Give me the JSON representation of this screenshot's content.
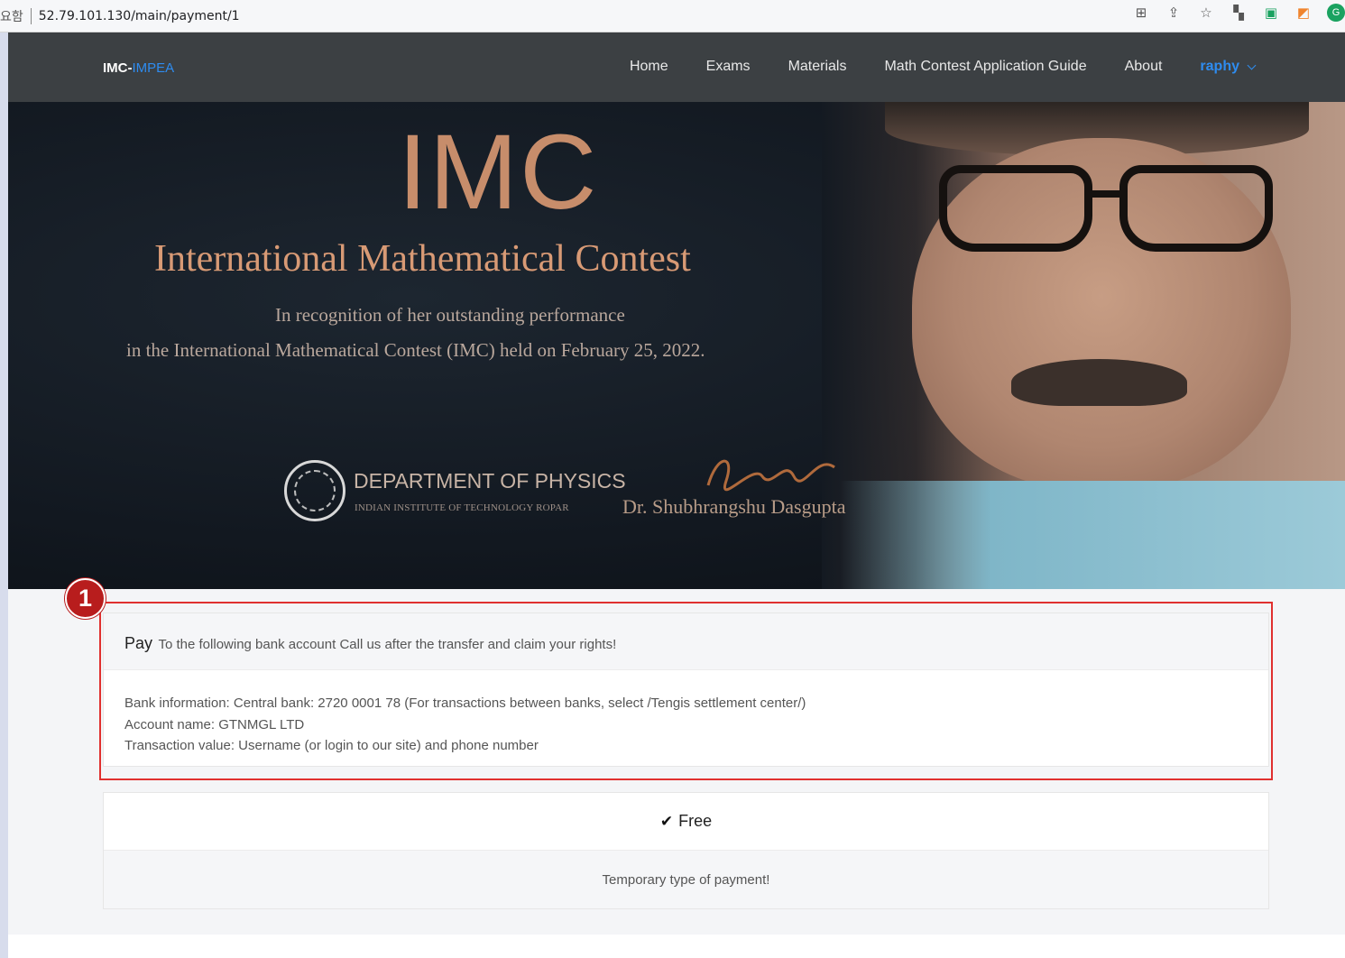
{
  "browser": {
    "url_prefix": "요함",
    "url": "52.79.101.130/main/payment/1",
    "icons": [
      "translate-icon",
      "share-icon",
      "star-icon",
      "extension-icon",
      "screen-icon",
      "chart-extension-icon",
      "grammarly-icon"
    ]
  },
  "navbar": {
    "brand_main": "IMC-",
    "brand_accent": "IMPEA",
    "links": [
      "Home",
      "Exams",
      "Materials",
      "Math Contest Application Guide",
      "About"
    ],
    "user": "raphy"
  },
  "hero": {
    "title": "IMC",
    "subtitle": "International Mathematical Contest",
    "line1": "In recognition of her outstanding performance",
    "line2": "in the International Mathematical Contest (IMC) held on February 25, 2022.",
    "department": "DEPARTMENT OF PHYSICS",
    "institute": "INDIAN INSTITUTE OF TECHNOLOGY ROPAR",
    "doctor": "Dr. Shubhrangshu Dasgupta"
  },
  "payment": {
    "head_strong": "Pay",
    "head_text": "To the following bank account Call us after the transfer and claim your rights!",
    "bank_info": "Bank information: Central bank: 2720 0001 78 (For transactions between banks, select /Tengis settlement center/)",
    "account_name": "Account name: GTNMGL LTD",
    "transaction_value": "Transaction value: Username (or login to our site) and phone number"
  },
  "annotation": {
    "step": "1",
    "color": "#e0302f"
  },
  "plan": {
    "label": "Free",
    "description": "Temporary type of payment!"
  },
  "colors": {
    "accent": "#2e8cf0",
    "navbar": "#3c4043",
    "hero_title": "#c78d6b"
  }
}
